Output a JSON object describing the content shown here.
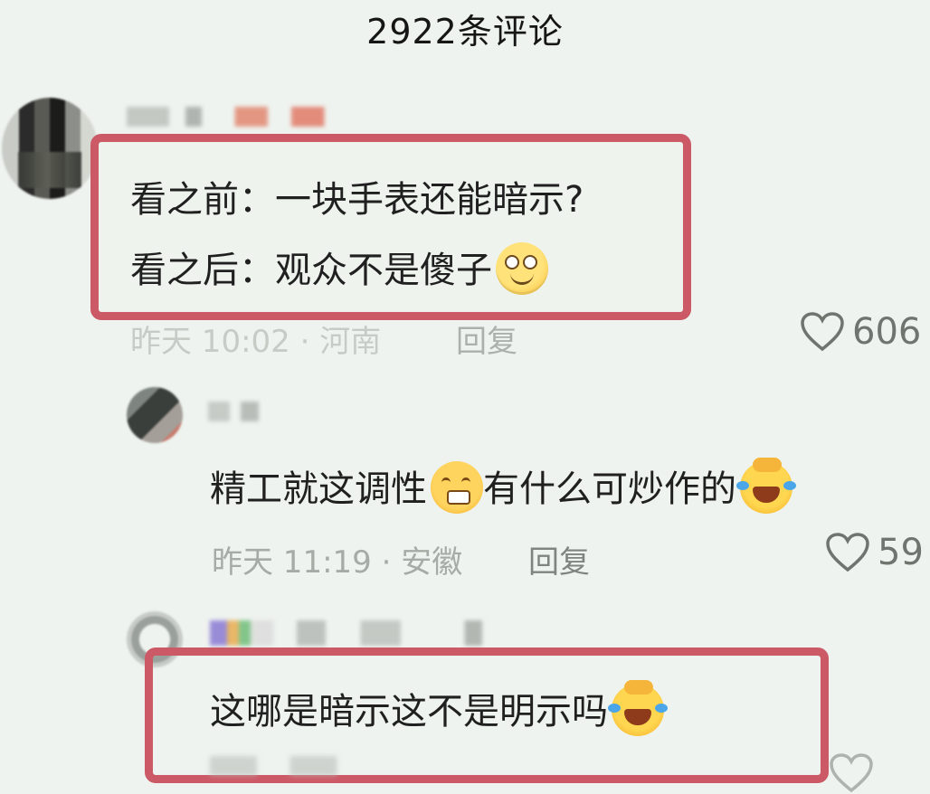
{
  "header": {
    "title": "2922条评论"
  },
  "comments": [
    {
      "lines": [
        "看之前：一块手表还能暗示?",
        "看之后：观众不是傻子"
      ],
      "emoji": [
        "smile-icon"
      ],
      "time_location": "昨天 10:02 · 河南",
      "reply_label": "回复",
      "likes": "606"
    },
    {
      "text_a": "精工就这调性",
      "text_b": "有什么可炒作的",
      "emoji": [
        "worried-face-icon",
        "laughing-tears-icon"
      ],
      "time_location": "昨天 11:19 · 安徽",
      "reply_label": "回复",
      "likes": "59"
    },
    {
      "text": "这哪是暗示这不是明示吗",
      "emoji": [
        "laughing-tears-icon"
      ]
    }
  ],
  "colors": {
    "background": "#eef3ef",
    "highlight_border": "#cc5966",
    "meta_text": "#a6aba6"
  }
}
